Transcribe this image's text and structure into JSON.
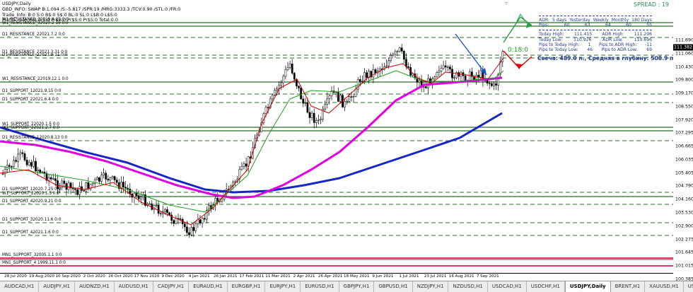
{
  "chart": {
    "symbol_title": "USDJPY,Daily",
    "info_lines": [
      "GBD_INFO: SWAP B:1.094 /S:-5.817 /SPR:19 /MRG:3333.3 /TCV:0.90 /STL:0 /FR:0",
      "Trade_Info: B:0 S:0 B$:0 S$:0 BL:0 SL:0 L$B:0 L$S:0",
      "Profits_Info: Pr$:0 S:0 Pr$B:0 Pr$S:0 Pr$S:0 Total:0.0"
    ],
    "spread_label": "SPREAD : 19",
    "timer": "0:18:0",
    "candle_info": "Свеча: 489.0 п., Средняя в глубину: 508.9 п.",
    "current_price": "111.382",
    "colors": {
      "candle": "#000000",
      "ma_fast": "#cc0000",
      "ma_mid": "#20a020",
      "ma_magenta": "#e000e0",
      "ma_blue": "#1626c8",
      "level_line": "#2c6e2c",
      "red_line": "#cc0033",
      "arrow_up": "#20a040",
      "arrow_down": "#e00000",
      "trend_arrow": "#1050d0"
    }
  },
  "price_axis": {
    "labels": [
      "111.690",
      "111.060",
      "110.430",
      "109.800",
      "109.170",
      "108.550",
      "107.920",
      "107.295",
      "106.665",
      "106.035",
      "105.405",
      "104.790",
      "104.160",
      "103.530",
      "102.900",
      "102.275",
      "101.645",
      "101.015",
      "100.385"
    ]
  },
  "time_axis": {
    "labels": [
      "28 Jul 2020",
      "19 Aug 2020",
      "10 Sep 2020",
      "2 Oct 2020",
      "26 Oct 2020",
      "17 Nov 2020",
      "9 Dec 2020",
      "4 Jan 2021",
      "26 Jan 2021",
      "17 Feb 2021",
      "11 Mar 2021",
      "2 Apr 2021",
      "26 Apr 2021",
      "18 May 2021",
      "9 Jun 2021",
      "1 Jul 2021",
      "23 Jul 2021",
      "16 Aug 2021",
      "7 Sep 2021"
    ]
  },
  "levels": [
    {
      "label": "W1_RESISTANCE_32019.4 21 0:0"
    },
    {
      "label": "W1_RESISTANCE_32020.2 16 0:0"
    },
    {
      "label": "D1_RESISTANCE_22021.7.2 0:0"
    },
    {
      "label": "D1_RESISTANCE_22021.3.31 0:0"
    },
    {
      "label": "D1_RESISTANCE_22021.9.11 0:0"
    },
    {
      "label": "W1_RESISTANCE_22019.12.1 0:0"
    },
    {
      "label": "D1_SUPPORT_12021.9.15 0:0"
    },
    {
      "label": "D1_SUPPORT_22021.6.4 0:0"
    },
    {
      "label": "W1_SUPPORT_22020.1.5 0:0"
    },
    {
      "label": "W1_SUPPORT_22021.2.7 0:0"
    },
    {
      "label": "D1_RESISTANCE_12020.8.13 0:0"
    },
    {
      "label": "D1_SUPPORT_12020.7.25 0:0"
    },
    {
      "label": "W1_SUPPORT_22020.1.5 0:0"
    },
    {
      "label": "D1_SUPPORT_42020.9.21 0:0"
    },
    {
      "label": "D1_SUPPORT_32020.11.6 0:0"
    },
    {
      "label": "D1_SUPPORT_42021.1.6 0:0"
    },
    {
      "label": "MN1_SUPPORT_32005.1.1 0:0"
    },
    {
      "label": "MN1_SUPPORT_4 1999.11.1 0:0"
    }
  ],
  "adr": {
    "header": [
      "ADR:",
      "5 days",
      "Yesterday",
      "Weekly",
      "Monthly",
      "180 Days"
    ],
    "pips": [
      "Pips:",
      "60",
      "63",
      "64",
      "60",
      "55"
    ],
    "rows": [
      [
        "Today High:",
        "111.415",
        "ADR High:",
        "111.296"
      ],
      [
        "Today Low:",
        "110.926",
        "ADR Low:",
        "110.696"
      ],
      [
        "Pips to Today High:",
        "1",
        "Pips to ADR High:",
        "-11"
      ],
      [
        "Pips to Today Low:",
        "46",
        "Pips to ADR Low:",
        "69"
      ]
    ]
  },
  "tabs": [
    {
      "label": "AUDCAD,H1"
    },
    {
      "label": "AUDJPY,H1"
    },
    {
      "label": "AUDNZD,H1"
    },
    {
      "label": "AUDUSD,H1"
    },
    {
      "label": "CADJPY,H1"
    },
    {
      "label": "EURAUD,H1"
    },
    {
      "label": "EURGBP,H1"
    },
    {
      "label": "EURJPY,H1"
    },
    {
      "label": "EURUSD,H1"
    },
    {
      "label": "GBPJPY,H1"
    },
    {
      "label": "GBPUSD,H1"
    },
    {
      "label": "NZDJPY,H1"
    },
    {
      "label": "NZDUSD,H1"
    },
    {
      "label": "USDCAD,H1"
    },
    {
      "label": "USDCHF,H1"
    },
    {
      "label": "USDJPY,Daily",
      "active": true
    },
    {
      "label": "BRENT,H1"
    },
    {
      "label": "XAUUSD,H1"
    },
    {
      "label": "USDRUB,H1"
    },
    {
      "label": "EURCHF,H1"
    }
  ]
}
